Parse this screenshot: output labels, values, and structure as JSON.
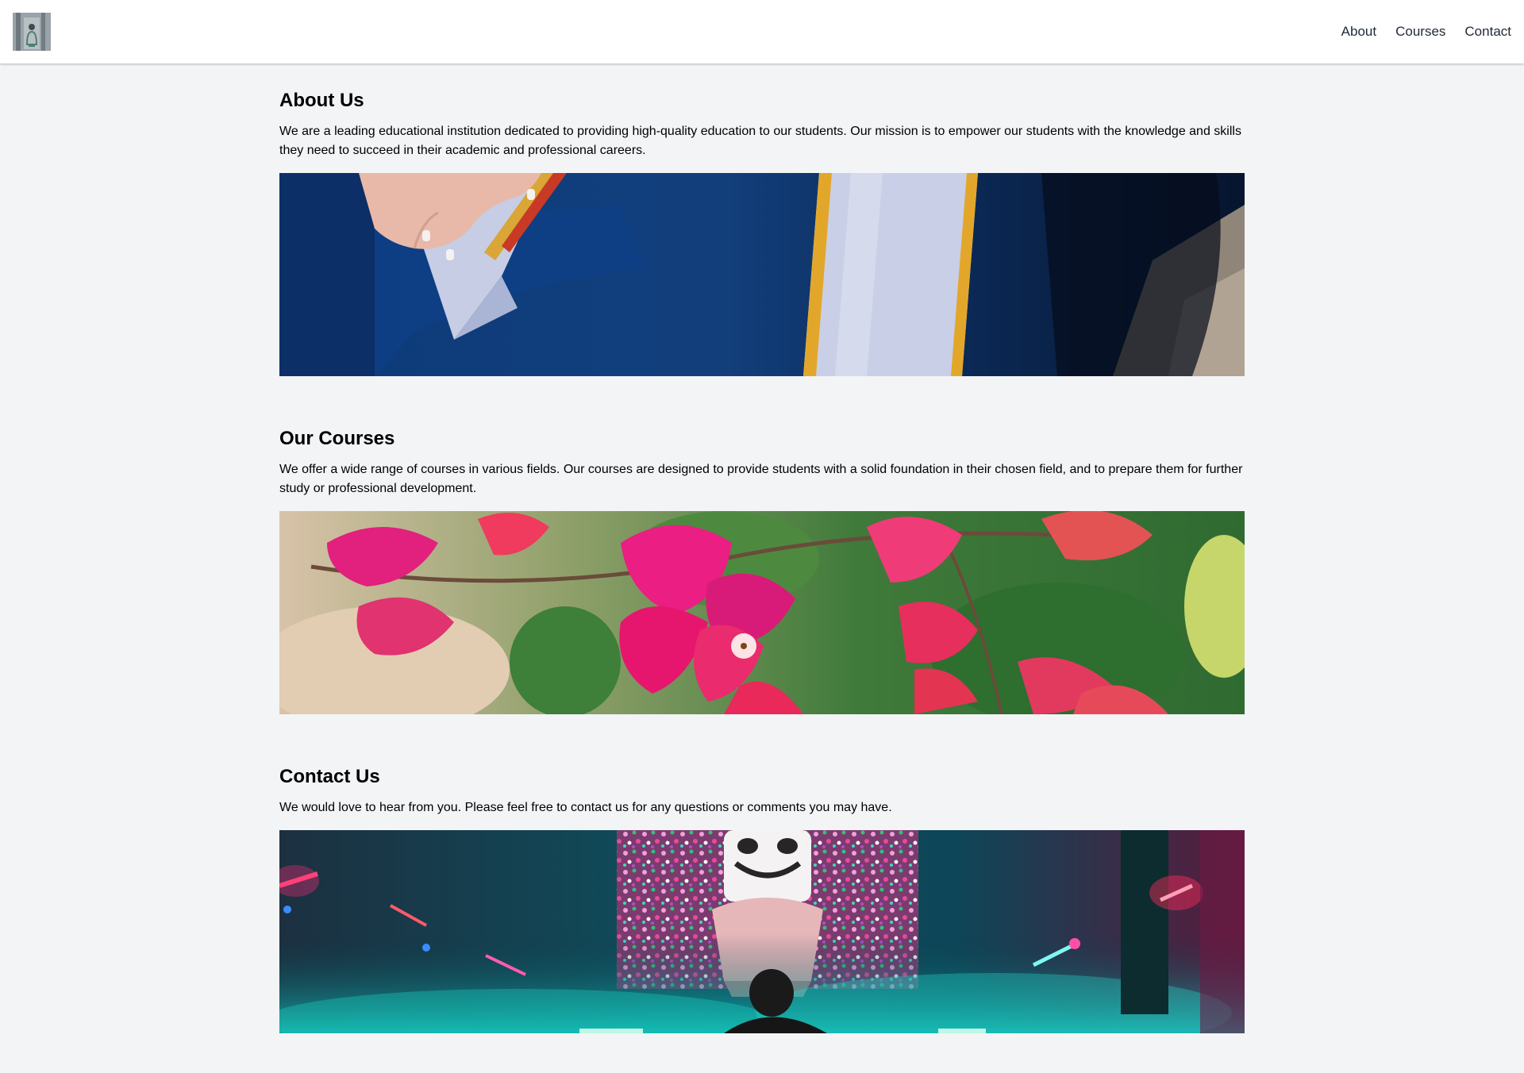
{
  "nav": {
    "logo_icon": "school-logo-icon",
    "items": [
      {
        "label": "About"
      },
      {
        "label": "Courses"
      },
      {
        "label": "Contact"
      }
    ]
  },
  "sections": [
    {
      "title": "About Us",
      "text": "We are a leading educational institution dedicated to providing high-quality education to our students. Our mission is to empower our students with the knowledge and skills they need to succeed in their academic and professional careers."
    },
    {
      "title": "Our Courses",
      "text": "We offer a wide range of courses in various fields. Our courses are designed to provide students with a solid foundation in their chosen field, and to prepare them for further study or professional development."
    },
    {
      "title": "Contact Us",
      "text": "We would love to hear from you. Please feel free to contact us for any questions or comments you may have."
    }
  ],
  "colors": {
    "page_background": "#f3f4f6",
    "header_background": "#ffffff",
    "nav_text": "#1f2937"
  }
}
